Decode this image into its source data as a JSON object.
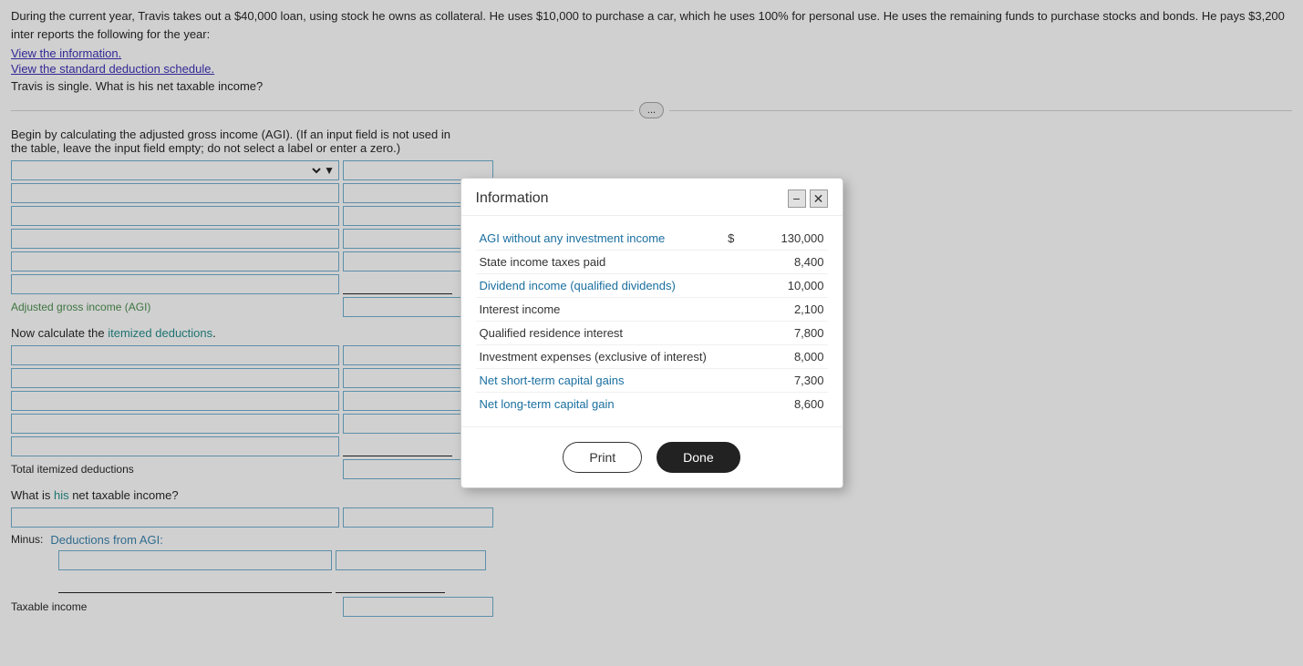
{
  "intro": {
    "text": "During the current year, Travis takes out a $40,000 loan, using stock he owns as collateral. He uses $10,000 to purchase a car, which he uses 100% for personal use. He uses the remaining funds to purchase stocks and bonds. He pays $3,200 inter reports the following for the year:",
    "link1": "View the information.",
    "link2": "View the standard deduction schedule.",
    "question": "Travis is single. What is his net taxable income?"
  },
  "divider": {
    "button_label": "..."
  },
  "agi_section": {
    "instruction": "Begin by calculating the adjusted gross income (AGI). (If an input field is not used in the table, leave the input field empty; do not select a label or enter a zero.)",
    "agi_label": "Adjusted gross income (AGI)",
    "dropdown_placeholder": ""
  },
  "itemized_section": {
    "heading": "Now calculate the itemized deductions.",
    "total_label": "Total itemized deductions"
  },
  "taxable_section": {
    "question": "What is his net taxable income?"
  },
  "minus_section": {
    "label": "Minus:",
    "deductions_label": "Deductions from AGI:"
  },
  "taxable_income": {
    "label": "Taxable income"
  },
  "modal": {
    "title": "Information",
    "rows": [
      {
        "label": "AGI without any investment income",
        "dollar": "$",
        "value": "130,000",
        "blue": true
      },
      {
        "label": "State income taxes paid",
        "dollar": "",
        "value": "8,400",
        "blue": false
      },
      {
        "label": "Dividend income (qualified dividends)",
        "dollar": "",
        "value": "10,000",
        "blue": true
      },
      {
        "label": "Interest income",
        "dollar": "",
        "value": "2,100",
        "blue": false
      },
      {
        "label": "Qualified residence interest",
        "dollar": "",
        "value": "7,800",
        "blue": false
      },
      {
        "label": "Investment expenses (exclusive of interest)",
        "dollar": "",
        "value": "8,000",
        "blue": false
      },
      {
        "label": "Net short-term capital gains",
        "dollar": "",
        "value": "7,300",
        "blue": true
      },
      {
        "label": "Net long-term capital gain",
        "dollar": "",
        "value": "8,600",
        "blue": true
      }
    ],
    "print_label": "Print",
    "done_label": "Done"
  }
}
